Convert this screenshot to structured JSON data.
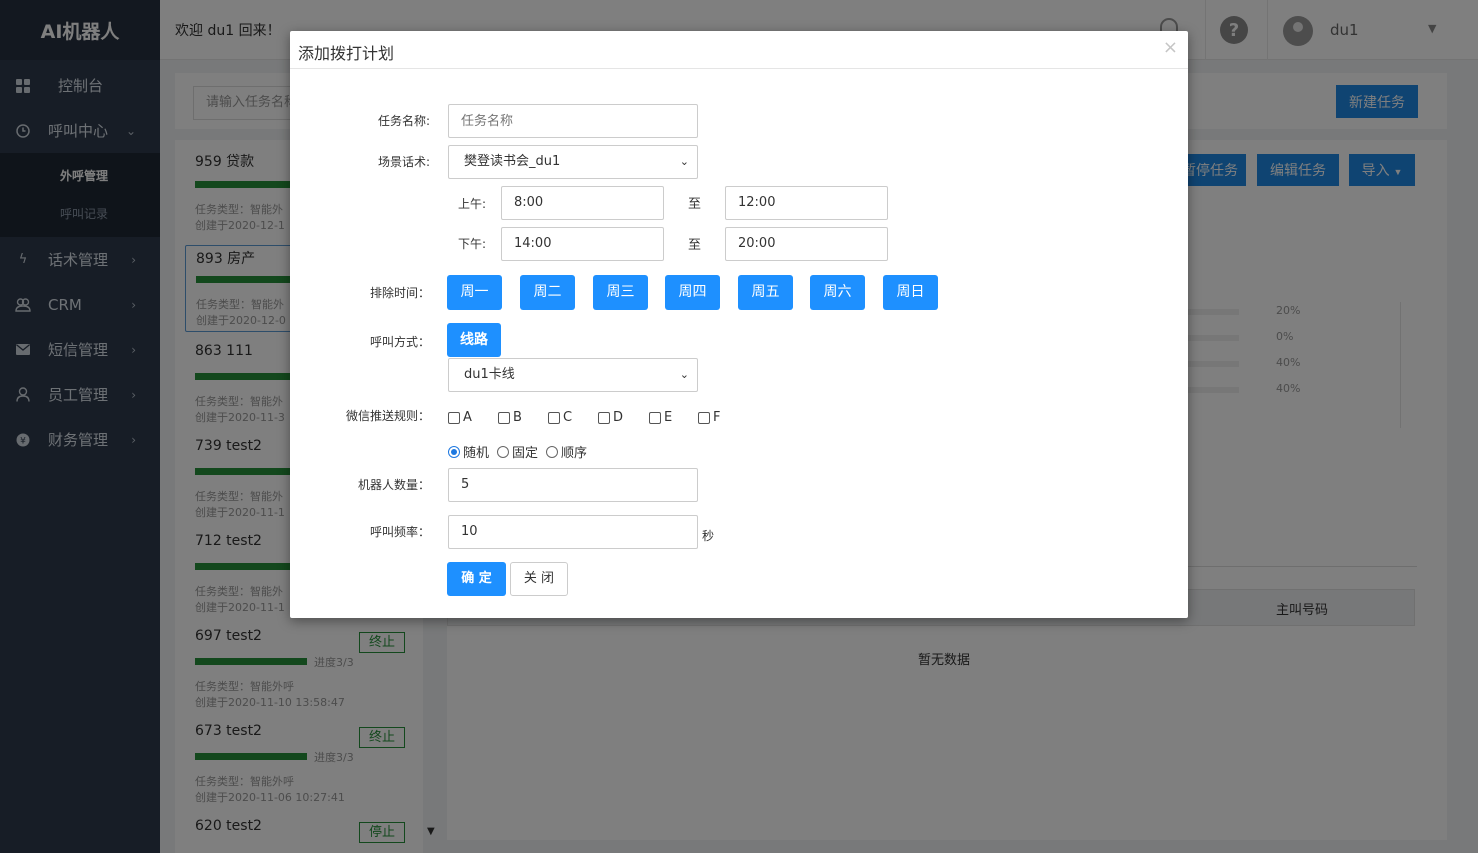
{
  "app": {
    "brand": "AI机器人",
    "welcome": "欢迎 du1 回来！",
    "user": "du1"
  },
  "sidebar": {
    "items": [
      {
        "label": "控制台",
        "icon": "grid-icon"
      },
      {
        "label": "呼叫中心",
        "icon": "clock-icon",
        "expanded": true,
        "children": [
          {
            "label": "外呼管理",
            "active": true
          },
          {
            "label": "呼叫记录",
            "active": false
          }
        ]
      },
      {
        "label": "话术管理",
        "icon": "bolt-icon"
      },
      {
        "label": "CRM",
        "icon": "users-icon"
      },
      {
        "label": "短信管理",
        "icon": "envelope-icon"
      },
      {
        "label": "员工管理",
        "icon": "user-icon"
      },
      {
        "label": "财务管理",
        "icon": "coin-icon"
      }
    ]
  },
  "toolbar": {
    "search_placeholder": "请输入任务名称",
    "new_task": "新建任务"
  },
  "tasks": [
    {
      "title": "959  贷款",
      "type": "任务类型：智能外",
      "date": "创建于2020-12-1"
    },
    {
      "title": "893  房产",
      "type": "任务类型：智能外",
      "date": "创建于2020-12-0"
    },
    {
      "title": "863   111",
      "type": "任务类型：智能外",
      "date": "创建于2020-11-3"
    },
    {
      "title": "739   test2",
      "type": "任务类型：智能外",
      "date": "创建于2020-11-1"
    },
    {
      "title": "712   test2",
      "type": "任务类型：智能外",
      "date": "创建于2020-11-1"
    },
    {
      "title": "697   test2",
      "type": "任务类型：智能外呼",
      "date": "创建于2020-11-10 13:58:47",
      "progress": "进度3/3",
      "action": "终止"
    },
    {
      "title": "673   test2",
      "type": "任务类型：智能外呼",
      "date": "创建于2020-11-06 10:27:41",
      "progress": "进度3/3",
      "action": "终止"
    },
    {
      "title": "620  test2",
      "action": "停止"
    }
  ],
  "detail": {
    "buttons": {
      "pause": "暂停任务",
      "edit": "编辑任务",
      "import": "导入"
    },
    "percentages": [
      "20%",
      "0%",
      "40%",
      "40%"
    ],
    "table_header_caller": "主叫号码",
    "no_data": "暂无数据"
  },
  "modal": {
    "title": "添加拨打计划",
    "close": "×",
    "task_name_label": "任务名称:",
    "task_name_placeholder": "任务名称",
    "scene_label": "场景话术:",
    "scene_value": "樊登读书会_du1",
    "am_label": "上午:",
    "am_start": "8:00",
    "am_end": "12:00",
    "pm_label": "下午:",
    "pm_start": "14:00",
    "pm_end": "20:00",
    "to_label": "至",
    "exclude_label": "排除时间：",
    "days": [
      "周一",
      "周二",
      "周三",
      "周四",
      "周五",
      "周六",
      "周日"
    ],
    "call_method_label": "呼叫方式：",
    "line_button": "线路",
    "line_value": "du1卡线",
    "wechat_label": "微信推送规则：",
    "wechat_options": [
      "A",
      "B",
      "C",
      "D",
      "E",
      "F"
    ],
    "order_options": [
      "随机",
      "固定",
      "顺序"
    ],
    "order_selected": "随机",
    "robot_label": "机器人数量：",
    "robot_value": "5",
    "freq_label": "呼叫频率：",
    "freq_value": "10",
    "freq_unit": "秒",
    "ok": "确 定",
    "cancel": "关 闭"
  }
}
